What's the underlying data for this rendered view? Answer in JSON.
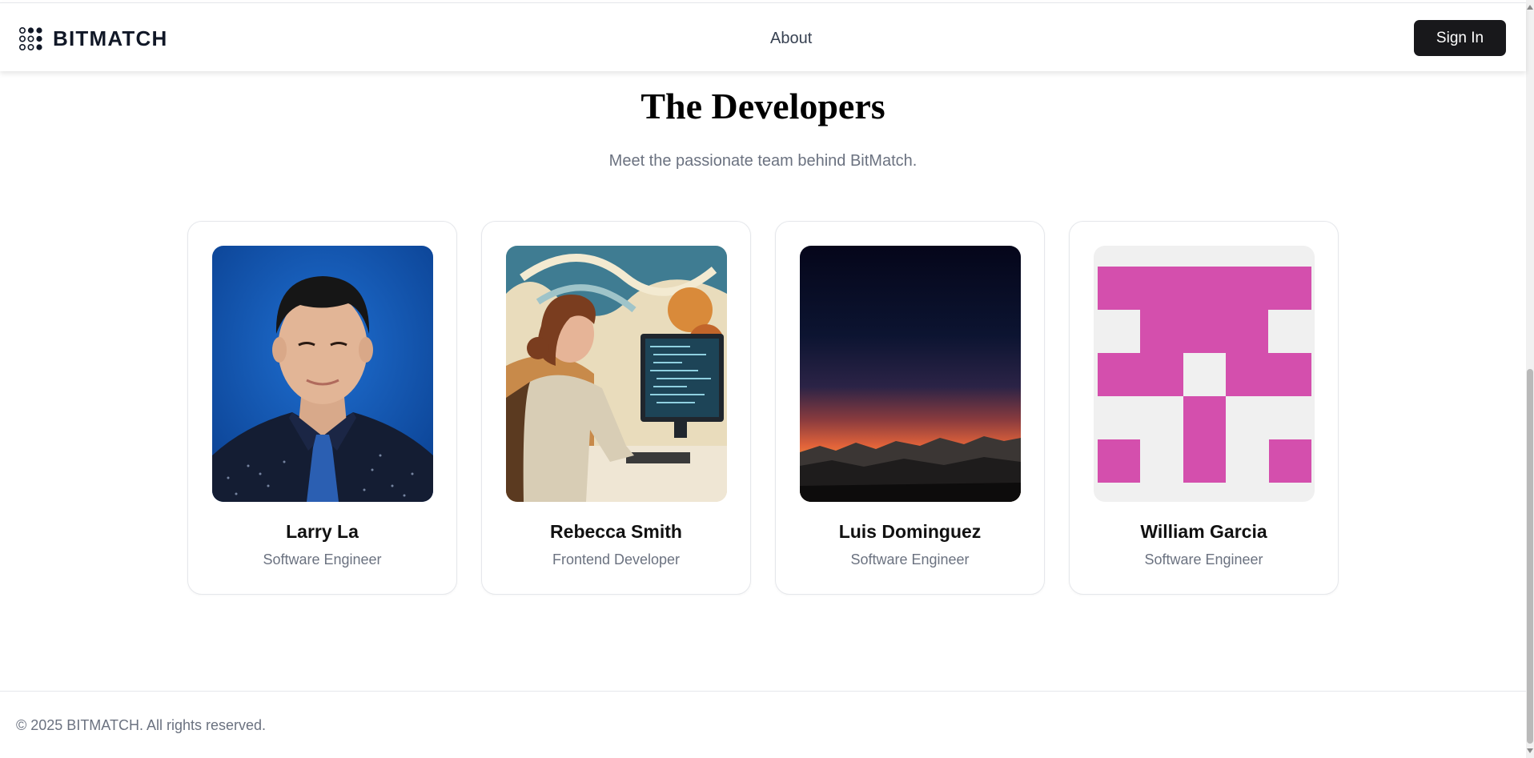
{
  "navbar": {
    "brand": "BITMATCH",
    "logo_icon": "dot-grid-logo-icon",
    "links": [
      {
        "label": "About"
      }
    ],
    "sign_in_label": "Sign In"
  },
  "main": {
    "title": "The Developers",
    "subtitle": "Meet the passionate team behind BitMatch.",
    "developers": [
      {
        "name": "Larry La",
        "role": "Software Engineer",
        "photo": "portrait-photo"
      },
      {
        "name": "Rebecca Smith",
        "role": "Frontend Developer",
        "photo": "illustration-woman-coding"
      },
      {
        "name": "Luis Dominguez",
        "role": "Software Engineer",
        "photo": "sunset-mountains-photo"
      },
      {
        "name": "William Garcia",
        "role": "Software Engineer",
        "photo": "identicon-avatar"
      }
    ]
  },
  "footer": {
    "copyright": "© 2025 BITMATCH. All rights reserved."
  },
  "colors": {
    "primary_button": "#18181b",
    "identicon": "#d44fad",
    "identicon_bg": "#f0f0f0",
    "muted_text": "#6b7280"
  }
}
